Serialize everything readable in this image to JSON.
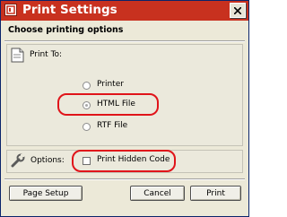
{
  "window": {
    "title": "Print Settings",
    "heading": "Choose printing options"
  },
  "print_to": {
    "label": "Print To:",
    "options": [
      {
        "label": "Printer",
        "selected": false
      },
      {
        "label": "HTML File",
        "selected": true
      },
      {
        "label": "RTF File",
        "selected": false
      }
    ]
  },
  "options": {
    "label": "Options:",
    "print_hidden_code": {
      "label": "Print Hidden Code",
      "checked": false
    }
  },
  "buttons": {
    "page_setup": "Page Setup",
    "cancel": "Cancel",
    "print": "Print"
  },
  "colors": {
    "titlebar": "#c8311f",
    "dialog_bg": "#ece9d8",
    "highlight": "#e0141a"
  },
  "icons": {
    "app": "app-icon",
    "close": "close-icon",
    "print_to": "document-icon",
    "options": "wrench-icon"
  }
}
